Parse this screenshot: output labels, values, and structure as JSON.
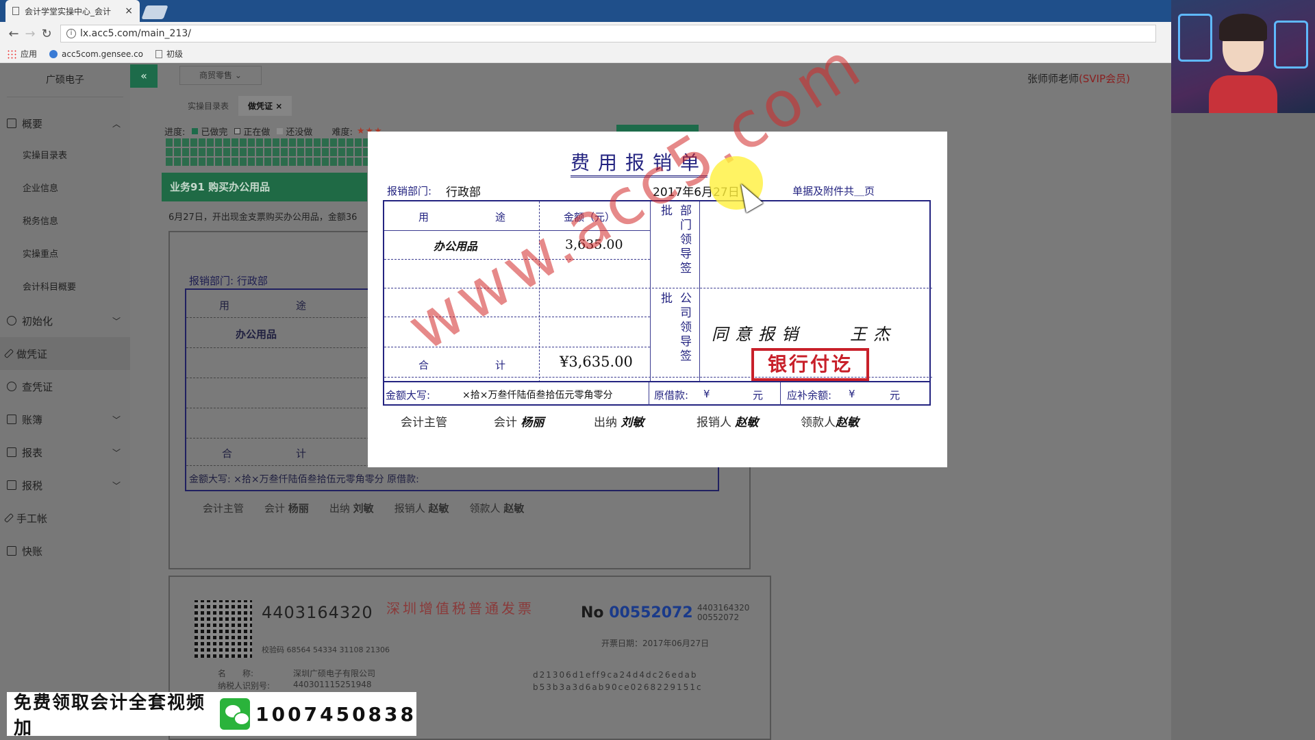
{
  "browser": {
    "tab_title": "会计学堂实操中心_会计",
    "url": "lx.acc5.com/main_213/",
    "bookmarks": [
      "应用",
      "acc5com.gensee.co",
      "初级"
    ]
  },
  "sidebar": {
    "company": "广硕电子",
    "items": [
      {
        "label": "概要",
        "expanded": true
      },
      {
        "label": "初始化"
      },
      {
        "label": "做凭证"
      },
      {
        "label": "查凭证"
      },
      {
        "label": "账簿"
      },
      {
        "label": "报表"
      },
      {
        "label": "报税"
      },
      {
        "label": "手工帐"
      },
      {
        "label": "快账"
      }
    ],
    "sub_items": [
      "实操目录表",
      "企业信息",
      "税务信息",
      "实操重点",
      "会计科目概要"
    ]
  },
  "topbar": {
    "collapse_icon": "«",
    "industry": "商贸零售",
    "user": "张师师老师",
    "user_level": "(SVIP会员)"
  },
  "subtabs": [
    "实操目录表",
    "做凭证"
  ],
  "progress": {
    "label": "进度:",
    "done": "已做完",
    "doing": "正在做",
    "todo": "还没做",
    "difficulty_label": "难度:",
    "difficulty_stars": "★★★"
  },
  "task": {
    "title": "业务91 购买办公用品",
    "description": "6月27日，开出现金支票购买办公用品，金额36"
  },
  "voucher": {
    "title": "费用报销单",
    "dept_label": "报销部门:",
    "dept": "行政部",
    "date": "2017年6月27日",
    "attachments": "单据及附件共＿页",
    "col_purpose_a": "用",
    "col_purpose_b": "途",
    "col_amount": "金额（元）",
    "item": "办公用品",
    "item_amount": "3,635.00",
    "total_a": "合",
    "total_b": "计",
    "total": "¥3,635.00",
    "dept_sign_label": "部门领导签批",
    "company_sign_label": "公司领导签批",
    "approval_text": "同意报销",
    "approver": "王杰",
    "stamp": "银行付讫",
    "amount_words_label": "金额大写:",
    "amount_words": "×拾×万叁仟陆佰叁拾伍元零角零分",
    "borrowed_label": "原借款:",
    "borrowed_value": "¥",
    "yuan1": "元",
    "balance_label": "应补余额:",
    "balance_value": "¥",
    "yuan2": "元",
    "chief_accountant": "会计主管",
    "accountant_label": "会计",
    "accountant": "杨丽",
    "cashier_label": "出纳",
    "cashier": "刘敏",
    "claimant_label": "报销人",
    "claimant": "赵敏",
    "receiver_label": "领款人",
    "receiver": "赵敏"
  },
  "invoice": {
    "code": "4403164320",
    "title": "深圳增值税普通发票",
    "no_label": "No",
    "no": "00552072",
    "code_small": "4403164320",
    "no_small": "00552072",
    "check_code": "校验码 68564 54334 31108 21306",
    "issue_date": "开票日期：2017年06月27日",
    "buyer_name_label": "名　　称:",
    "buyer_name": "深圳广硕电子有限公司",
    "buyer_tax_label": "纳税人识别号:",
    "buyer_tax": "440301115251948",
    "cipher": "d21306d1eff9ca24d4dc26edab",
    "cipher2": "b53b3a3d6ab90ce0268229151c"
  },
  "watermark": "www.acc5.com",
  "promo": {
    "text": "免费领取会计全套视频加",
    "number": "1007450838"
  }
}
